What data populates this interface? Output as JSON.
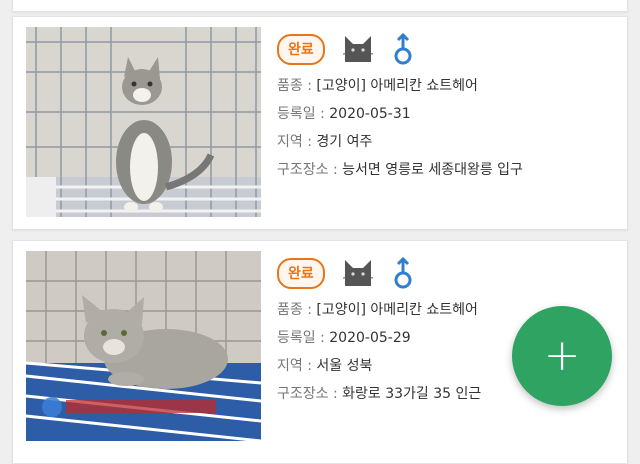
{
  "listings": [
    {
      "status": "완료",
      "breed_label": "품종 : ",
      "breed_value": "[고양이] 아메리칸 쇼트헤어",
      "date_label": "등록일 : ",
      "date_value": "2020-05-31",
      "region_label": "지역 : ",
      "region_value": "경기 여주",
      "rescue_label": "구조장소 : ",
      "rescue_value": "능서면 영릉로 세종대왕릉 입구",
      "species_icon": "cat-icon",
      "gender_icon": "male-icon"
    },
    {
      "status": "완료",
      "breed_label": "품종 : ",
      "breed_value": "[고양이] 아메리칸 쇼트헤어",
      "date_label": "등록일 : ",
      "date_value": "2020-05-29",
      "region_label": "지역 : ",
      "region_value": "서울 성북",
      "rescue_label": "구조장소 : ",
      "rescue_value": "화랑로 33가길 35 인근",
      "species_icon": "cat-icon",
      "gender_icon": "male-icon"
    }
  ],
  "fab": {
    "label": "+"
  },
  "colors": {
    "badge": "#e8751a",
    "male": "#2f7fd1",
    "fab": "#2fa361",
    "cat": "#555555"
  }
}
